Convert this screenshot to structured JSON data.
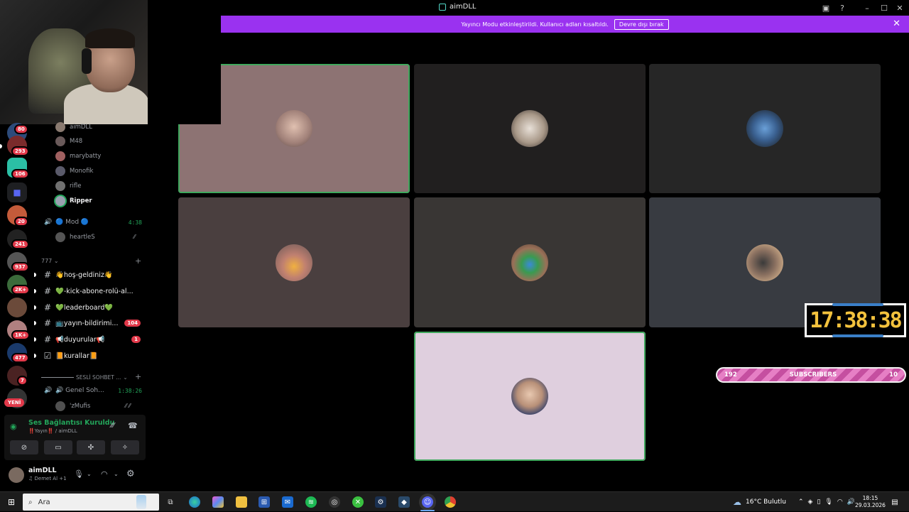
{
  "titlebar": {
    "title": "aimDLL"
  },
  "banner": {
    "message": "Yayıncı Modu etkinleştirildi. Kullanıcı adları kısaltıldı.",
    "button_label": "Devre dışı bırak"
  },
  "server_badges": [
    "80",
    "293",
    "106",
    "20",
    "241",
    "937",
    "2K+",
    "1K+",
    "477",
    "7"
  ],
  "new_label": "YENİ",
  "voice_members_top": [
    "aimDLL",
    "M48",
    "marybatty",
    "Monofik",
    "rifle",
    "Ripper"
  ],
  "mod_channel": {
    "label": "🔵 Mod 🔵",
    "time": "4:38",
    "member": "heartleS"
  },
  "category": {
    "name": "777"
  },
  "channels": [
    {
      "label": "👋hoş-geldiniz👋",
      "badge": ""
    },
    {
      "label": "💚-kick-abone-rolü-al...",
      "badge": ""
    },
    {
      "label": "💚leaderboard💚",
      "badge": ""
    },
    {
      "label": "📺yayın-bildirimi...",
      "badge": "104"
    },
    {
      "label": "📢duyurular📢",
      "badge": "1"
    },
    {
      "label": "📙kurallar📙",
      "badge": ""
    }
  ],
  "voice_category": {
    "name": "SESLİ SOHBET ..."
  },
  "voice_channel": {
    "label": "🔊 Genel Soh...",
    "time": "1:38:26",
    "member": "'zMufis"
  },
  "voice_status": {
    "title": "Ses Bağlantısı Kuruldu",
    "subtitle": "‼️Yayın‼️ / aimDLL"
  },
  "user": {
    "name": "aimDLL",
    "status": "Demet Al +1"
  },
  "clock": "17:38:38",
  "subs": {
    "left": "192",
    "label": "SUBSCRIBERS",
    "right": "10"
  },
  "taskbar": {
    "search_placeholder": "Ara",
    "weather": "16°C  Bulutlu",
    "time": "18:15",
    "date": "29.03.2026"
  },
  "colors": {
    "accent": "#9a32f0",
    "voice_green": "#23a55a",
    "badge_red": "#e2394a",
    "clock_gold": "#f3c23d"
  }
}
